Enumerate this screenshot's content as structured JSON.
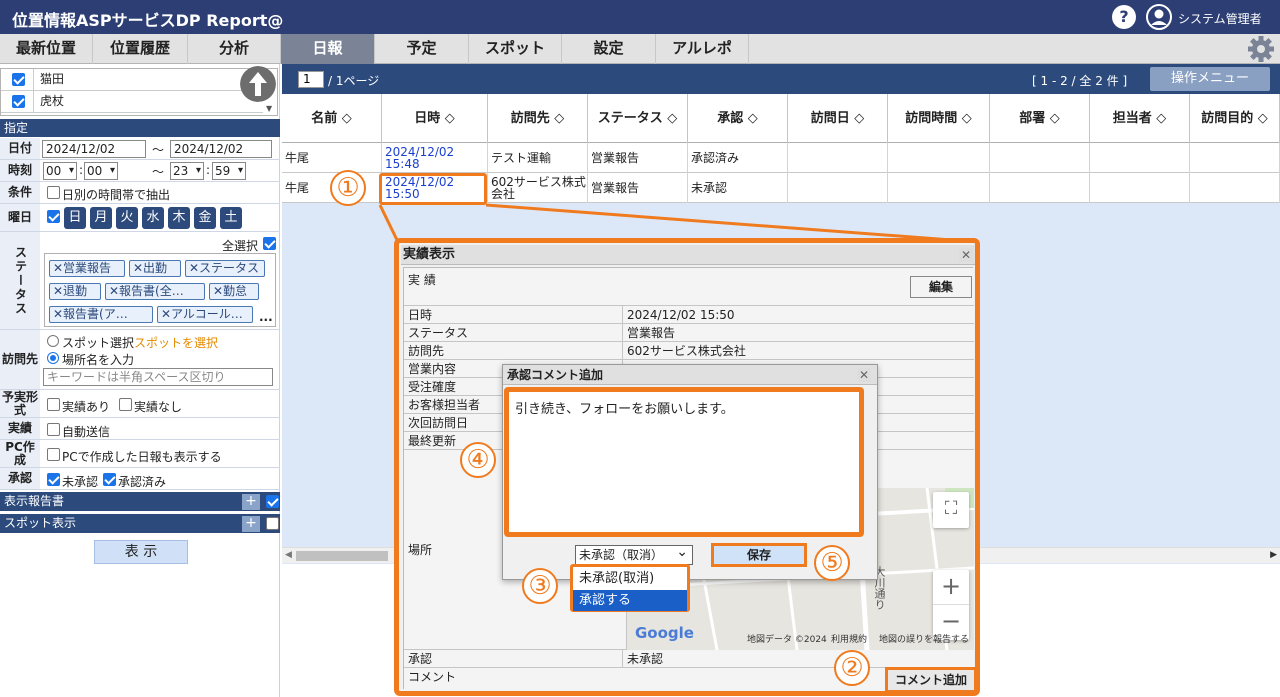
{
  "header": {
    "title": "位置情報ASPサービスDP Report@",
    "help_icon": "?",
    "user_name": "システム管理者"
  },
  "nav": {
    "tabs": [
      "最新位置",
      "位置履歴",
      "分析",
      "日報",
      "予定",
      "スポット",
      "設定",
      "アルレポ"
    ],
    "active_tab": "日報"
  },
  "sidebar": {
    "users": [
      "猫田",
      "虎杖"
    ],
    "section_designation": "指定",
    "date": {
      "label": "日付",
      "from": "2024/12/02",
      "sep": "〜",
      "to": "2024/12/02"
    },
    "time": {
      "label": "時刻",
      "from_h": "00",
      "from_m": "00",
      "sep": "〜",
      "to_h": "23",
      "to_m": "59",
      "colon": ":"
    },
    "condition": {
      "label": "条件",
      "option": "日別の時間帯で抽出"
    },
    "weekday": {
      "label": "曜日",
      "days": [
        "日",
        "月",
        "火",
        "水",
        "木",
        "金",
        "土"
      ]
    },
    "status": {
      "label": "ステータス",
      "select_all": "全選択",
      "tags": [
        "✕営業報告",
        "✕出勤",
        "✕ステータス",
        "✕退勤",
        "✕報告書(全…",
        "✕勤怠",
        "✕報告書(ア…",
        "✕アルコール…"
      ],
      "more": "..."
    },
    "visit": {
      "label": "訪問先",
      "spot_select": "スポット選択",
      "spot_link": "スポットを選択",
      "place_input": "場所名を入力",
      "keyword_placeholder": "キーワードは半角スペース区切り"
    },
    "plan_actual": {
      "label": "予実形式",
      "opt1": "実績あり",
      "opt2": "実績なし"
    },
    "actual": {
      "label": "実績",
      "opt": "自動送信"
    },
    "pc": {
      "label": "PC作成",
      "opt": "PCで作成した日報も表示する"
    },
    "approval": {
      "label": "承認",
      "opt1": "未承認",
      "opt2": "承認済み"
    },
    "section_report": "表示報告書",
    "section_spot": "スポット表示",
    "display_button": "表 示",
    "plus": "+"
  },
  "main": {
    "page": "1",
    "page_total": "/ 1ページ",
    "range": "[ 1 - 2 / 全 2 件 ]",
    "ops_button": "操作メニュー",
    "columns": [
      "名前 ◇",
      "日時 ◇",
      "訪問先 ◇",
      "ステータス ◇",
      "承認 ◇",
      "訪問日 ◇",
      "訪問時間 ◇",
      "部署 ◇",
      "担当者 ◇",
      "訪問目的 ◇"
    ],
    "rows": [
      {
        "name": "牛尾",
        "datetime": "2024/12/02 15:48",
        "visit": "テスト運輸",
        "status": "営業報告",
        "approval": "承認済み"
      },
      {
        "name": "牛尾",
        "datetime": "2024/12/02 15:50",
        "visit": "602サービス株式会社",
        "status": "営業報告",
        "approval": "未承認"
      }
    ]
  },
  "dialog_result": {
    "title": "実績表示",
    "close": "✕",
    "section": "実 績",
    "edit_button": "編集",
    "fields": [
      {
        "label": "日時",
        "value": "2024/12/02 15:50"
      },
      {
        "label": "ステータス",
        "value": "営業報告"
      },
      {
        "label": "訪問先",
        "value": "602サービス株式会社"
      },
      {
        "label": "営業内容",
        "value": ""
      },
      {
        "label": "受注確度",
        "value": ""
      },
      {
        "label": "お客様担当者",
        "value": ""
      },
      {
        "label": "次回訪問日",
        "value": ""
      },
      {
        "label": "最終更新",
        "value": ""
      }
    ],
    "place_label": "場所",
    "approval_label": "承認",
    "approval_value": "未承認",
    "comment_label": "コメント",
    "comment_button": "コメント追加",
    "map": {
      "google": "Google",
      "attrib1": "地図データ ©2024",
      "attrib2": "利用規約",
      "attrib3": "地図の誤りを報告する",
      "road": "大川通り",
      "zoom_in": "+",
      "zoom_out": "−"
    }
  },
  "dialog_comment": {
    "title": "承認コメント追加",
    "close": "✕",
    "text": "引き続き、フォローをお願いします。",
    "select_value": "未承認（取消）",
    "options": [
      "未承認(取消)",
      "承認する"
    ],
    "save_button": "保存"
  },
  "callouts": [
    "①",
    "②",
    "③",
    "④",
    "⑤"
  ],
  "colors": {
    "header": "#2c3e73",
    "accent": "#f07b1f",
    "link": "#1a3fd0"
  }
}
